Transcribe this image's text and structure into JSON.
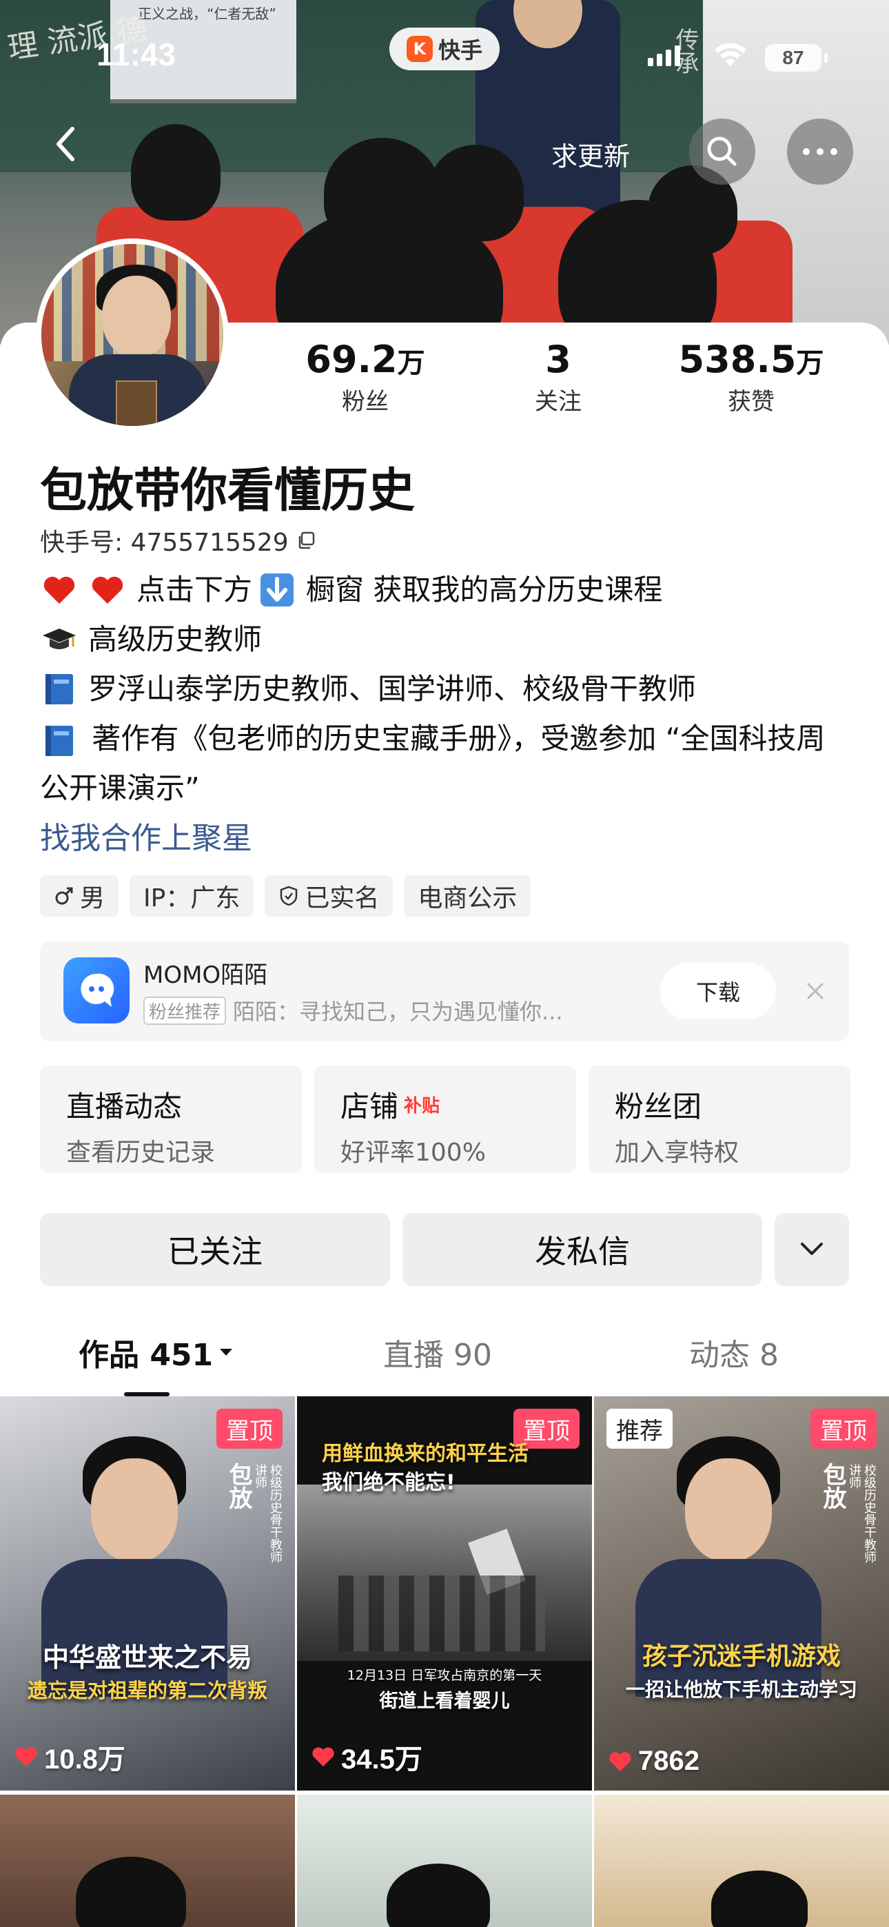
{
  "status_bar": {
    "time": "11:43",
    "app_name": "快手",
    "battery": "87"
  },
  "banner": {
    "screen_text": "正义之战，“仁者无敌”",
    "chalk_left": "理 流派 德",
    "chalk_right": "传承"
  },
  "nav": {
    "request_update": "求更新"
  },
  "profile": {
    "name": "包放带你看懂历史",
    "kuaishou_id_label": "快手号: 4755715529",
    "stats": [
      {
        "value": "69.2",
        "unit": "万",
        "label": "粉丝"
      },
      {
        "value": "3",
        "unit": "",
        "label": "关注"
      },
      {
        "value": "538.5",
        "unit": "万",
        "label": "获赞"
      }
    ],
    "bio": [
      "点击下方",
      "橱窗 获取我的高分历史课程",
      "高级历史教师",
      "罗浮山泰学历史教师、国学讲师、校级骨干教师",
      "著作有《包老师的历史宝藏手册》，受邀参加 “全国科技周公开课演示”"
    ],
    "link": "找我合作上聚星",
    "tags": [
      {
        "icon": "male-icon",
        "text": "男"
      },
      {
        "icon": "",
        "text": "IP：广东"
      },
      {
        "icon": "verified-shield-icon",
        "text": "已实名"
      },
      {
        "icon": "",
        "text": "电商公示"
      }
    ]
  },
  "ad": {
    "title": "MOMO陌陌",
    "badge": "粉丝推荐",
    "subtitle": "陌陌：寻找知己，只为遇见懂你...",
    "download": "下载"
  },
  "features": [
    {
      "title": "直播动态",
      "badge": "",
      "sub": "查看历史记录"
    },
    {
      "title": "店铺",
      "badge": "补贴",
      "sub": "好评率100%"
    },
    {
      "title": "粉丝团",
      "badge": "",
      "sub": "加入享特权"
    }
  ],
  "actions": {
    "followed": "已关注",
    "message": "发私信"
  },
  "tabs": [
    {
      "label": "作品 451",
      "active": true
    },
    {
      "label": "直播 90",
      "active": false
    },
    {
      "label": "动态 8",
      "active": false
    }
  ],
  "videos": [
    {
      "pin": "置顶",
      "rec": "",
      "likes": "10.8万",
      "title": "中华盛世来之不易",
      "subtitle": "遗忘是对祖辈的第二次背叛",
      "side_name": "包放",
      "side_small": "校级历史骨干教师讲师"
    },
    {
      "pin": "置顶",
      "rec": "",
      "likes": "34.5万",
      "title": "用鲜血换来的和平生活",
      "title2": "我们绝不能忘!",
      "subtitle": "12月13日 日军攻占南京的第一天",
      "subtitle2": "街道上看着婴儿"
    },
    {
      "pin": "置顶",
      "rec": "推荐",
      "likes": "7862",
      "title": "孩子沉迷手机游戏",
      "subtitle": "一招让他放下手机主动学习",
      "side_name": "包放",
      "side_small": "校级历史骨干教师讲师"
    }
  ],
  "colors": {
    "accent_pin": "#ff4a6a",
    "link": "#3a5a8f",
    "heart": "#ff3b4a",
    "kuaishou_orange": "#ff5a1f"
  }
}
